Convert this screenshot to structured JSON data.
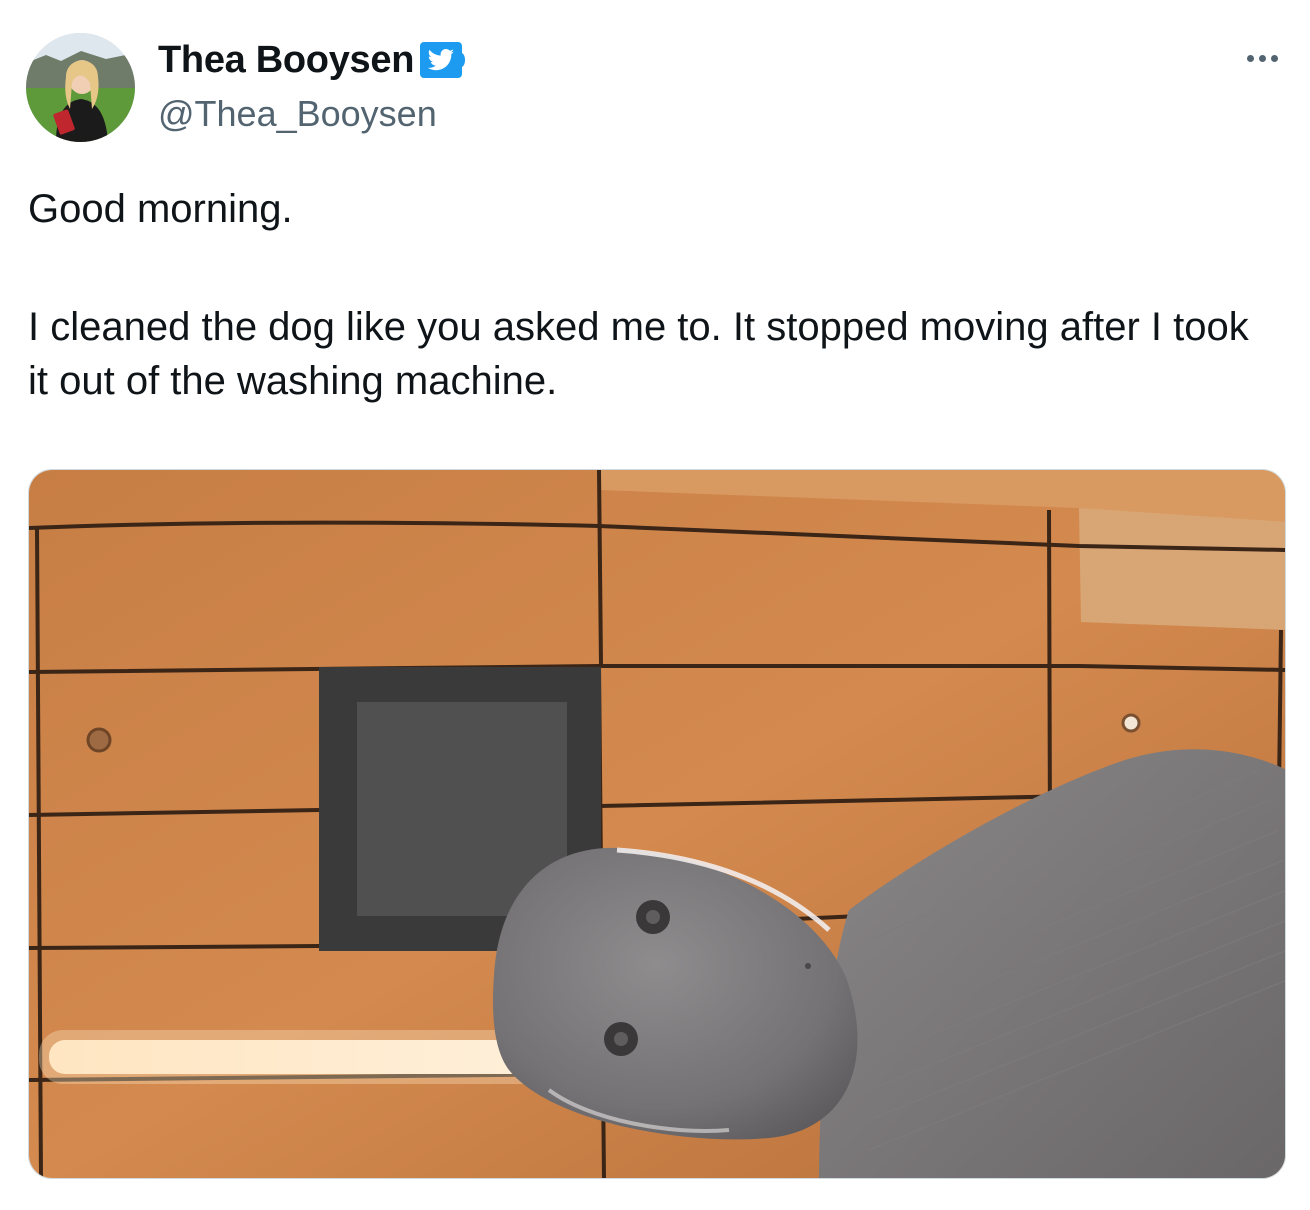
{
  "tweet": {
    "author": {
      "display_name": "Thea Booysen",
      "handle": "@Thea_Booysen",
      "verified": true,
      "verified_icon": "twitter-bird-verified-icon",
      "avatar_icon": "profile-photo"
    },
    "more_icon": "ellipsis-icon",
    "text": {
      "line1": "Good morning.",
      "line2": "I cleaned the dog like you asked me to. It stopped moving after I took it out of the washing machine."
    },
    "media": {
      "kind": "photo",
      "subject": "robot-dog-photo"
    }
  },
  "colors": {
    "text_primary": "#0f1419",
    "text_secondary": "#536471",
    "verified_blue": "#1d9bf0",
    "media_border": "#cfd9de"
  }
}
